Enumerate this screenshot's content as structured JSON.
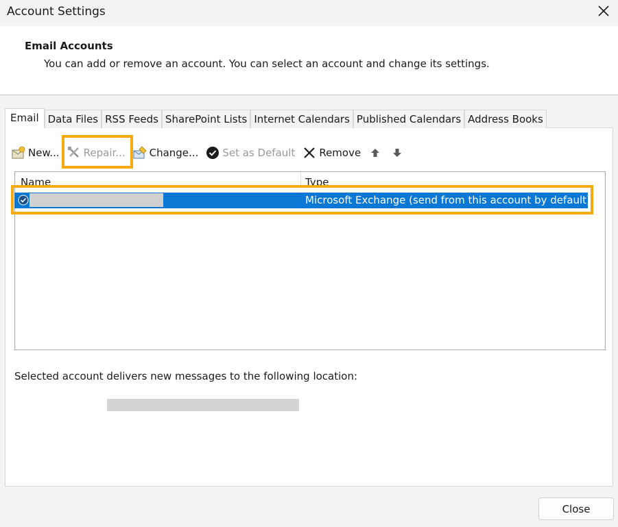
{
  "window": {
    "title": "Account Settings"
  },
  "header": {
    "title": "Email Accounts",
    "subtitle": "You can add or remove an account. You can select an account and change its settings."
  },
  "tabs": [
    {
      "label": "Email",
      "active": true
    },
    {
      "label": "Data Files",
      "active": false
    },
    {
      "label": "RSS Feeds",
      "active": false
    },
    {
      "label": "SharePoint Lists",
      "active": false
    },
    {
      "label": "Internet Calendars",
      "active": false
    },
    {
      "label": "Published Calendars",
      "active": false
    },
    {
      "label": "Address Books",
      "active": false
    }
  ],
  "toolbar": {
    "new_label": "New...",
    "repair_label": "Repair...",
    "change_label": "Change...",
    "set_default_label": "Set as Default",
    "remove_label": "Remove"
  },
  "accounts": {
    "columns": {
      "name": "Name",
      "type": "Type"
    },
    "rows": [
      {
        "type": "Microsoft Exchange (send from this account by default)",
        "selected": true,
        "default": true
      }
    ]
  },
  "delivery": {
    "label": "Selected account delivers new messages to the following location:"
  },
  "footer": {
    "close_label": "Close"
  },
  "colors": {
    "selection": "#0a78d4",
    "highlight": "#f6aa10"
  }
}
